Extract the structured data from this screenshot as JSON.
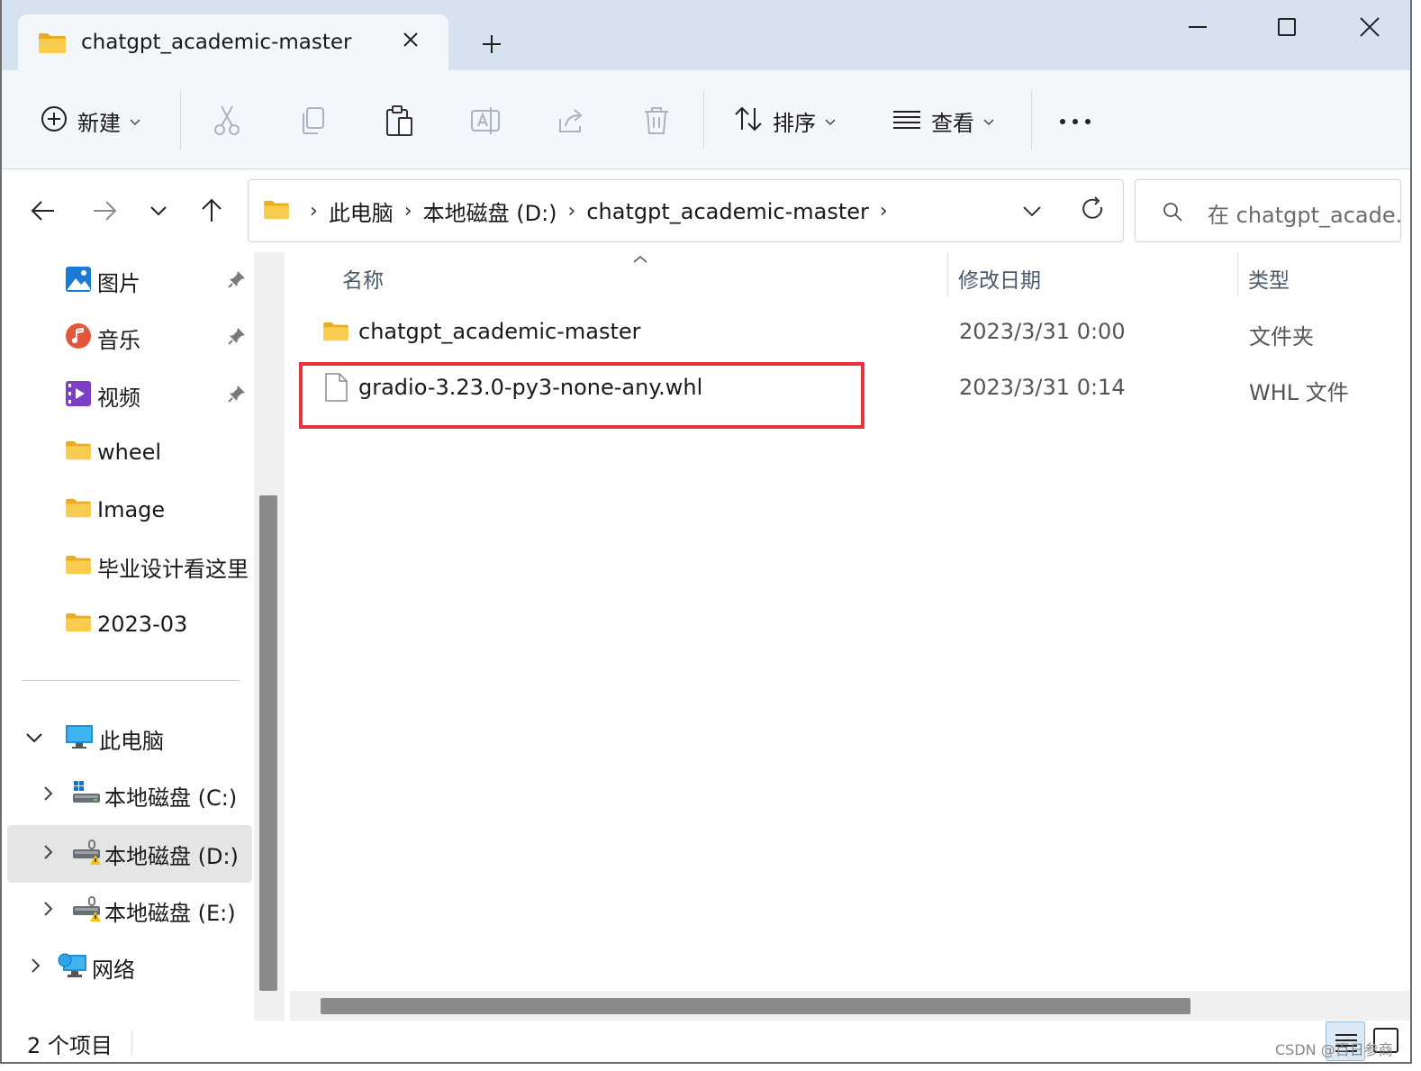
{
  "window": {
    "tab_title": "chatgpt_academic-master",
    "new_tab_symbol": "+"
  },
  "toolbar": {
    "new_label": "新建",
    "sort_label": "排序",
    "view_label": "查看",
    "more_label": "•••"
  },
  "address": {
    "crumbs": [
      "此电脑",
      "本地磁盘 (D:)",
      "chatgpt_academic-master"
    ]
  },
  "search": {
    "placeholder": "在 chatgpt_acade..."
  },
  "sidebar": {
    "quick_access": [
      {
        "label": "图片",
        "icon": "pictures-icon",
        "pinned": true
      },
      {
        "label": "音乐",
        "icon": "music-icon",
        "pinned": true
      },
      {
        "label": "视频",
        "icon": "videos-icon",
        "pinned": true
      },
      {
        "label": "wheel",
        "icon": "folder-icon",
        "pinned": false
      },
      {
        "label": "Image",
        "icon": "folder-icon",
        "pinned": false
      },
      {
        "label": "毕业设计看这里",
        "icon": "folder-icon",
        "pinned": false
      },
      {
        "label": "2023-03",
        "icon": "folder-icon",
        "pinned": false
      }
    ],
    "this_pc": "此电脑",
    "drives": [
      {
        "label": "本地磁盘 (C:)",
        "icon": "windows-drive-icon",
        "selected": false
      },
      {
        "label": "本地磁盘 (D:)",
        "icon": "warning-drive-icon",
        "selected": true
      },
      {
        "label": "本地磁盘 (E:)",
        "icon": "warning-drive-icon",
        "selected": false
      }
    ],
    "network": "网络"
  },
  "content": {
    "columns": {
      "name": "名称",
      "modified": "修改日期",
      "type": "类型"
    },
    "files": [
      {
        "name": "chatgpt_academic-master",
        "modified": "2023/3/31 0:00",
        "type": "文件夹",
        "icon": "folder-icon"
      },
      {
        "name": "gradio-3.23.0-py3-none-any.whl",
        "modified": "2023/3/31 0:14",
        "type": "WHL 文件",
        "icon": "file-icon",
        "highlighted": true
      }
    ]
  },
  "status": {
    "item_count": "2 个项目"
  },
  "watermark": "CSDN @百日参商",
  "colors": {
    "titlebar": "#d6e2ef",
    "toolbar": "#f3f6fa",
    "highlight_box": "#e8313b",
    "folder": "#f5c441"
  }
}
